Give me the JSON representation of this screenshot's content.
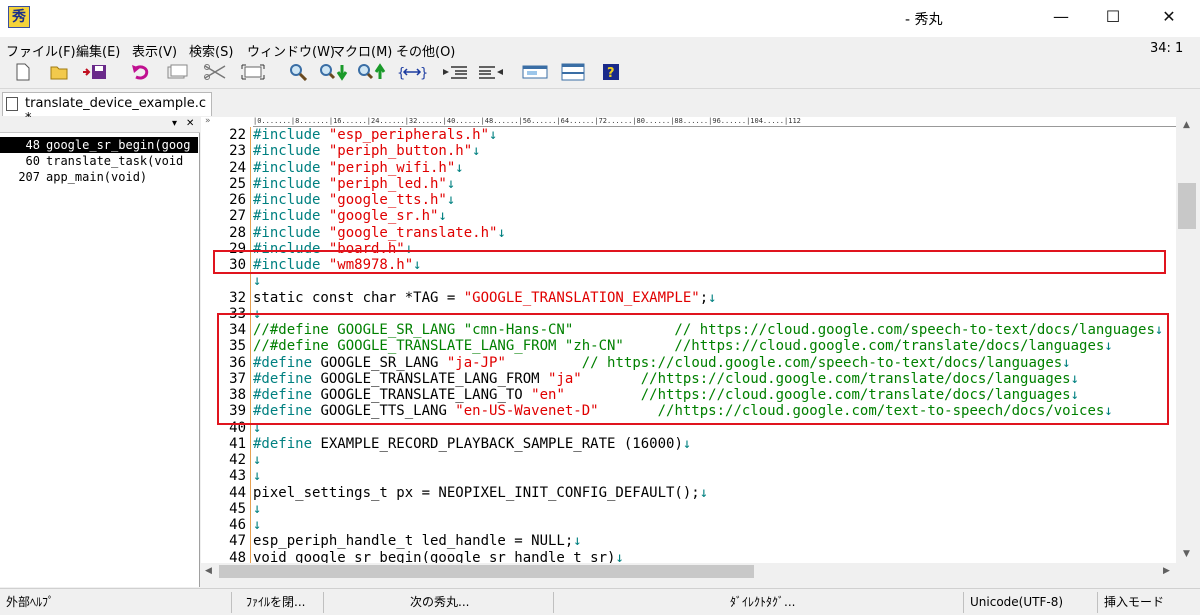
{
  "window": {
    "title": "- 秀丸",
    "app_icon": "秀",
    "minimize": "—",
    "maximize": "☐",
    "close": "✕"
  },
  "menu": [
    "ファイル(F)",
    "編集(E)",
    "表示(V)",
    "検索(S)",
    "ウィンドウ(W)",
    "マクロ(M)",
    "その他(O)"
  ],
  "cursor_position": "34: 1",
  "toolbar_icons": [
    "new-file-icon",
    "open-folder-icon",
    "save-icon",
    "undo-icon",
    "copy-icon",
    "cut-icon",
    "paste-icon",
    "search-icon",
    "search-down-icon",
    "search-up-icon",
    "bracket-jump-icon",
    "indent-icon",
    "outdent-icon",
    "window-icon",
    "split-window-icon",
    "help-icon"
  ],
  "tab": {
    "label": "translate_device_example.c *"
  },
  "outline": {
    "dropdown": "▾",
    "close": "✕",
    "items": [
      {
        "line": "48",
        "name": "google_sr_begin(goog",
        "selected": true
      },
      {
        "line": "60",
        "name": "translate_task(void",
        "selected": false
      },
      {
        "line": "207",
        "name": "app_main(void)",
        "selected": false
      }
    ]
  },
  "ruler": "|0.......|8.......|16......|24......|32......|40......|48......|56......|64......|72......|80......|88......|96......|104.....|112",
  "lines": [
    {
      "n": "22",
      "segs": [
        [
          "kw",
          "#include "
        ],
        [
          "str",
          "\"esp_peripherals.h\""
        ],
        [
          "nl",
          "↓"
        ]
      ]
    },
    {
      "n": "23",
      "segs": [
        [
          "kw",
          "#include "
        ],
        [
          "str",
          "\"periph_button.h\""
        ],
        [
          "nl",
          "↓"
        ]
      ]
    },
    {
      "n": "24",
      "segs": [
        [
          "kw",
          "#include "
        ],
        [
          "str",
          "\"periph_wifi.h\""
        ],
        [
          "nl",
          "↓"
        ]
      ]
    },
    {
      "n": "25",
      "segs": [
        [
          "kw",
          "#include "
        ],
        [
          "str",
          "\"periph_led.h\""
        ],
        [
          "nl",
          "↓"
        ]
      ]
    },
    {
      "n": "26",
      "segs": [
        [
          "kw",
          "#include "
        ],
        [
          "str",
          "\"google_tts.h\""
        ],
        [
          "nl",
          "↓"
        ]
      ]
    },
    {
      "n": "27",
      "segs": [
        [
          "kw",
          "#include "
        ],
        [
          "str",
          "\"google_sr.h\""
        ],
        [
          "nl",
          "↓"
        ]
      ]
    },
    {
      "n": "28",
      "segs": [
        [
          "kw",
          "#include "
        ],
        [
          "str",
          "\"google_translate.h\""
        ],
        [
          "nl",
          "↓"
        ]
      ]
    },
    {
      "n": "29",
      "segs": [
        [
          "kw",
          "#include "
        ],
        [
          "str",
          "\"board.h\""
        ],
        [
          "nl",
          "↓"
        ]
      ]
    },
    {
      "n": "30",
      "segs": [
        [
          "kw",
          "#include "
        ],
        [
          "str",
          "\"wm8978.h\""
        ],
        [
          "nl",
          "↓"
        ]
      ]
    },
    {
      "n": "",
      "segs": [
        [
          "nl",
          "↓"
        ]
      ]
    },
    {
      "n": "32",
      "segs": [
        [
          "",
          "static const char *TAG = "
        ],
        [
          "str",
          "\"GOOGLE_TRANSLATION_EXAMPLE\""
        ],
        [
          "",
          ";"
        ],
        [
          "nl",
          "↓"
        ]
      ]
    },
    {
      "n": "33",
      "segs": [
        [
          "nl",
          "↓"
        ]
      ]
    },
    {
      "n": "34",
      "segs": [
        [
          "cm",
          "//#define GOOGLE_SR_LANG \"cmn-Hans-CN\"            // https://cloud.google.com/speech-to-text/docs/languages"
        ],
        [
          "nl",
          "↓"
        ]
      ]
    },
    {
      "n": "35",
      "segs": [
        [
          "cm",
          "//#define GOOGLE_TRANSLATE_LANG_FROM \"zh-CN\"      //https://cloud.google.com/translate/docs/languages"
        ],
        [
          "nl",
          "↓"
        ]
      ]
    },
    {
      "n": "36",
      "segs": [
        [
          "kw",
          "#define "
        ],
        [
          "",
          "GOOGLE_SR_LANG "
        ],
        [
          "str",
          "\"ja-JP\""
        ],
        [
          "cm",
          "         // https://cloud.google.com/speech-to-text/docs/languages"
        ],
        [
          "nl",
          "↓"
        ]
      ]
    },
    {
      "n": "37",
      "segs": [
        [
          "kw",
          "#define "
        ],
        [
          "",
          "GOOGLE_TRANSLATE_LANG_FROM "
        ],
        [
          "str",
          "\"ja\""
        ],
        [
          "cm",
          "       //https://cloud.google.com/translate/docs/languages"
        ],
        [
          "nl",
          "↓"
        ]
      ]
    },
    {
      "n": "38",
      "segs": [
        [
          "kw",
          "#define "
        ],
        [
          "",
          "GOOGLE_TRANSLATE_LANG_TO "
        ],
        [
          "str",
          "\"en\""
        ],
        [
          "cm",
          "         //https://cloud.google.com/translate/docs/languages"
        ],
        [
          "nl",
          "↓"
        ]
      ]
    },
    {
      "n": "39",
      "segs": [
        [
          "kw",
          "#define "
        ],
        [
          "",
          "GOOGLE_TTS_LANG "
        ],
        [
          "str",
          "\"en-US-Wavenet-D\""
        ],
        [
          "cm",
          "       //https://cloud.google.com/text-to-speech/docs/voices"
        ],
        [
          "nl",
          "↓"
        ]
      ]
    },
    {
      "n": "40",
      "segs": [
        [
          "nl",
          "↓"
        ]
      ]
    },
    {
      "n": "41",
      "segs": [
        [
          "kw",
          "#define "
        ],
        [
          "",
          "EXAMPLE_RECORD_PLAYBACK_SAMPLE_RATE (16000)"
        ],
        [
          "nl",
          "↓"
        ]
      ]
    },
    {
      "n": "42",
      "segs": [
        [
          "nl",
          "↓"
        ]
      ]
    },
    {
      "n": "43",
      "segs": [
        [
          "nl",
          "↓"
        ]
      ]
    },
    {
      "n": "44",
      "segs": [
        [
          "",
          "pixel_settings_t px = NEOPIXEL_INIT_CONFIG_DEFAULT();"
        ],
        [
          "nl",
          "↓"
        ]
      ]
    },
    {
      "n": "45",
      "segs": [
        [
          "nl",
          "↓"
        ]
      ]
    },
    {
      "n": "46",
      "segs": [
        [
          "nl",
          "↓"
        ]
      ]
    },
    {
      "n": "47",
      "segs": [
        [
          "",
          "esp_periph_handle_t led_handle = NULL;"
        ],
        [
          "nl",
          "↓"
        ]
      ]
    },
    {
      "n": "48",
      "segs": [
        [
          "",
          "void google_sr_begin(google_sr_handle_t sr)"
        ],
        [
          "nl",
          "↓"
        ]
      ]
    }
  ],
  "status": {
    "help": "外部ﾍﾙﾌﾟ",
    "close_file": "ﾌｧｲﾙを閉...",
    "next_hidemaru": "次の秀丸...",
    "direct_tag": "ﾀﾞｲﾚｸﾄﾀｸﾞ...",
    "encoding": "Unicode(UTF-8)",
    "mode": "挿入モード"
  }
}
